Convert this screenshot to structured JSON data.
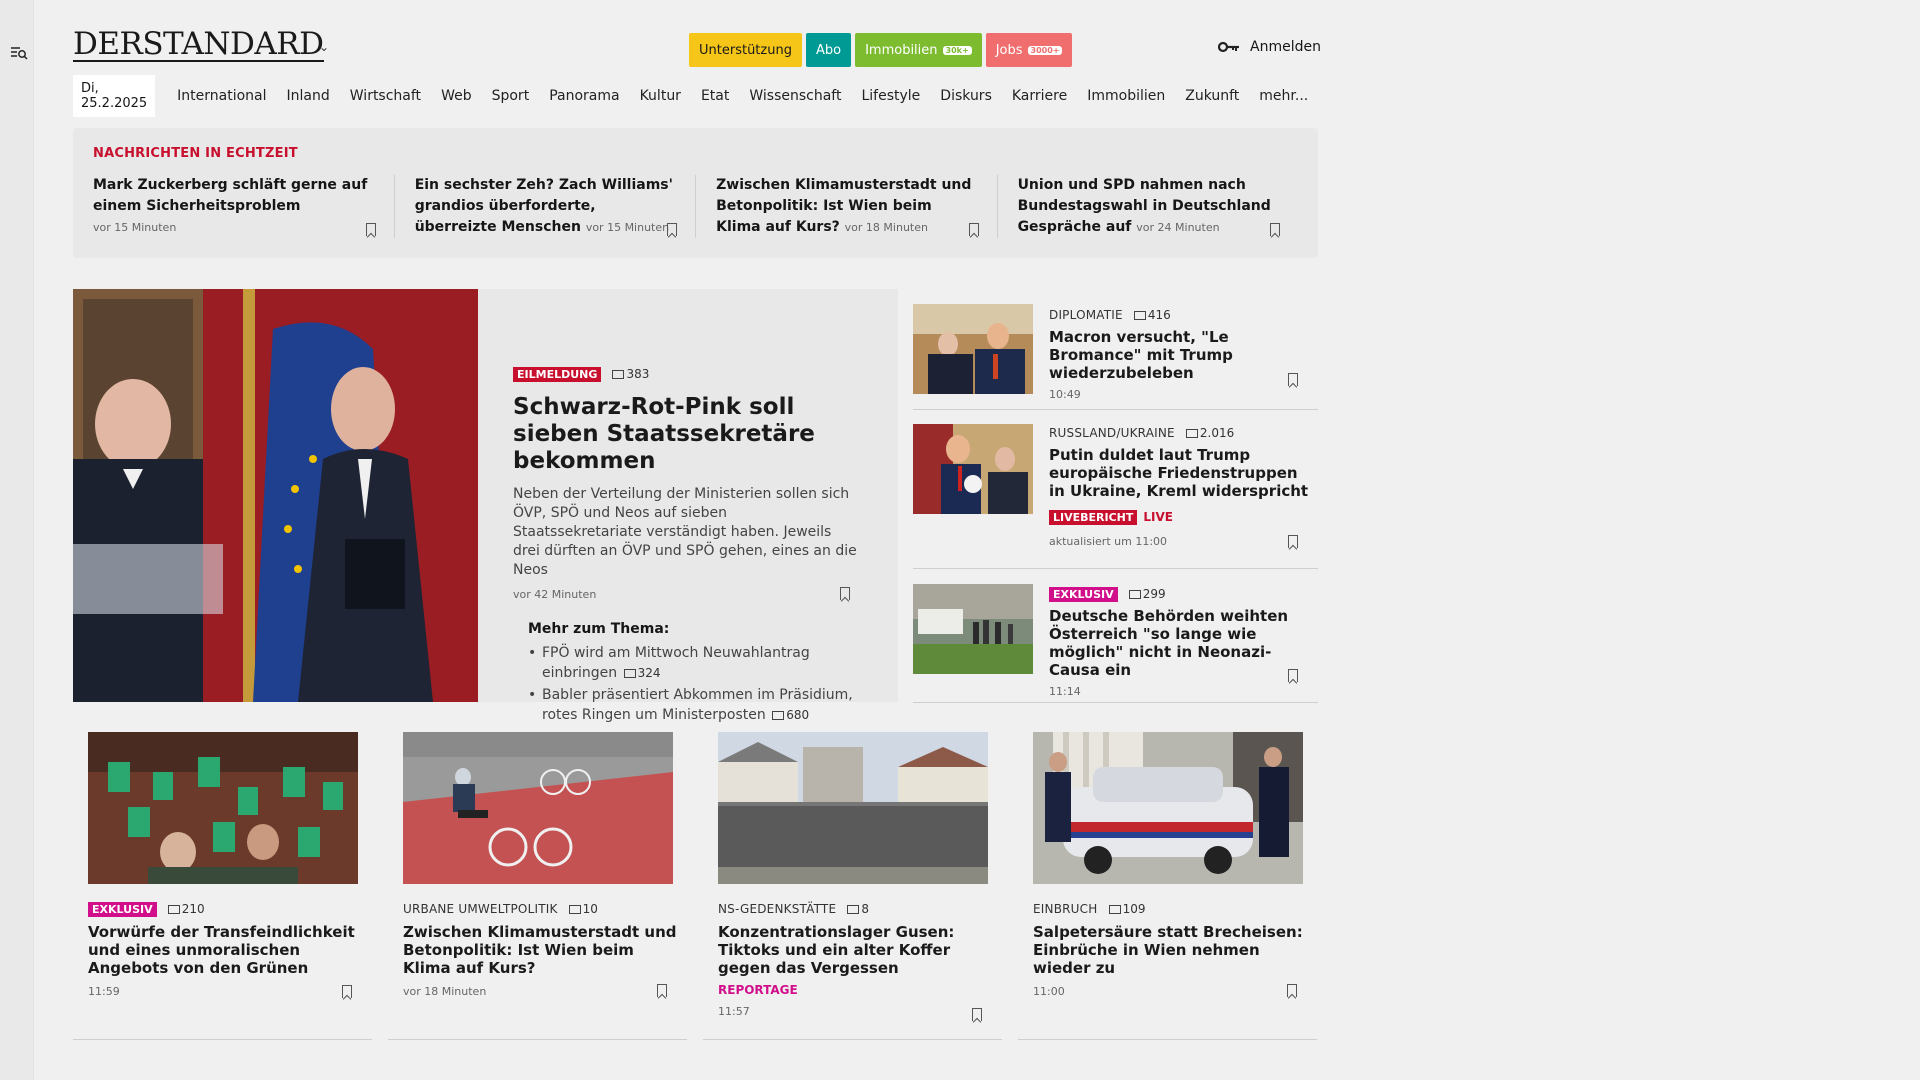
{
  "header": {
    "logo": "DERSTANDARD",
    "promos": [
      {
        "label": "Unterstützung",
        "tag": "",
        "bg": "#f5c518",
        "fg": "#1a1a1a"
      },
      {
        "label": "Abo",
        "tag": "",
        "bg": "#009a95",
        "fg": "#ffffff"
      },
      {
        "label": "Immobilien",
        "tag": "30k+",
        "bg": "#7dbb2f",
        "fg": "#ffffff"
      },
      {
        "label": "Jobs",
        "tag": "3000+",
        "bg": "#f06e6e",
        "fg": "#ffffff"
      }
    ],
    "login": "Anmelden"
  },
  "nav": {
    "date": "Di, 25.2.2025",
    "items": [
      "International",
      "Inland",
      "Wirtschaft",
      "Web",
      "Sport",
      "Panorama",
      "Kultur",
      "Etat",
      "Wissenschaft",
      "Lifestyle",
      "Diskurs",
      "Karriere",
      "Immobilien",
      "Zukunft",
      "mehr..."
    ]
  },
  "ticker": {
    "title": "NACHRICHTEN IN ECHTZEIT",
    "items": [
      {
        "title": "Mark Zuckerberg schläft gerne auf einem Sicherheitsproblem",
        "time": "vor 15 Minuten"
      },
      {
        "title": "Ein sechster Zeh? Zach Williams' grandios überforderte, überreizte Menschen",
        "time": "vor 15 Minuten"
      },
      {
        "title": "Zwischen Klimamusterstadt und Betonpolitik: Ist Wien beim Klima auf Kurs?",
        "time": "vor 18 Minuten"
      },
      {
        "title": "Union und SPD nahmen nach Bundestagswahl in Deutschland Gespräche auf",
        "time": "vor 24 Minuten"
      }
    ]
  },
  "lead": {
    "badge": "EILMELDUNG",
    "comments": "383",
    "title": "Schwarz-Rot-Pink soll sieben Staatssekretäre bekommen",
    "text": "Neben der Verteilung der Ministerien sollen sich ÖVP, SPÖ und Neos auf sieben Staatssekretariate verständigt haben. Jeweils drei dürften an ÖVP und SPÖ gehen, eines an die Neos",
    "time": "vor 42 Minuten",
    "more_title": "Mehr zum Thema:",
    "more": [
      {
        "text": "FPÖ wird am Mittwoch Neuwahlantrag einbringen",
        "comments": "324"
      },
      {
        "text": "Babler präsentiert Abkommen im Präsidium, rotes Ringen um Ministerposten",
        "comments": "680"
      }
    ]
  },
  "right": [
    {
      "kicker": "DIPLOMATIE",
      "comments": "416",
      "title": "Macron versucht, \"Le Bromance\" mit Trump wiederzubeleben",
      "time": "10:49"
    },
    {
      "kicker": "RUSSLAND/UKRAINE",
      "comments": "2.016",
      "title": "Putin duldet laut Trump europäische Friedenstruppen in Ukraine, Kreml widerspricht",
      "badge": "LIVEBERICHT",
      "live": "LIVE",
      "time": "aktualisiert um 11:00"
    },
    {
      "badge": "EXKLUSIV",
      "comments": "299",
      "title": "Deutsche Behörden weihten Österreich \"so lange wie möglich\" nicht in Neonazi-Causa ein",
      "time": "11:14"
    }
  ],
  "cards": [
    {
      "badge": "EXKLUSIV",
      "comments": "210",
      "title": "Vorwürfe der Transfeindlichkeit und eines unmoralischen Angebots von den Grünen",
      "time": "11:59"
    },
    {
      "kicker": "URBANE UMWELTPOLITIK",
      "comments": "10",
      "title": "Zwischen Klimamusterstadt und Betonpolitik: Ist Wien beim Klima auf Kurs?",
      "time": "vor 18 Minuten"
    },
    {
      "kicker": "NS-GEDENKSTÄTTE",
      "comments": "8",
      "title": "Konzentrationslager Gusen: Tiktoks und ein alter Koffer gegen das Vergessen",
      "tag": "REPORTAGE",
      "time": "11:57"
    },
    {
      "kicker": "EINBRUCH",
      "comments": "109",
      "title": "Salpetersäure statt Brecheisen: Einbrüche in Wien nehmen wieder zu",
      "time": "11:00"
    }
  ],
  "icons": {
    "menu": "search-menu-icon",
    "key": "key-icon",
    "bookmark": "bookmark-icon",
    "comment": "comment-icon",
    "chevron": "chevron-down-icon"
  }
}
